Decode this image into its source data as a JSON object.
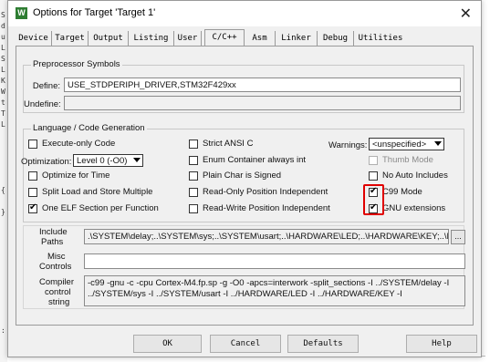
{
  "background": {
    "left_chars": [
      "S",
      "d",
      "u",
      "L",
      "S",
      "L",
      "K",
      "W",
      "t",
      "T",
      "L",
      "{",
      "}",
      ":"
    ]
  },
  "window": {
    "title": "Options for Target 'Target 1'",
    "app_icon_letter": "W",
    "close_glyph": "✕"
  },
  "tabs": [
    "Device",
    "Target",
    "Output",
    "Listing",
    "User",
    "C/C++",
    "Asm",
    "Linker",
    "Debug",
    "Utilities"
  ],
  "active_tab": "C/C++",
  "preprocessor": {
    "group_label": "Preprocessor Symbols",
    "define_label": "Define:",
    "define_value": "USE_STDPERIPH_DRIVER,STM32F429xx",
    "undefine_label": "Undefine:",
    "undefine_value": ""
  },
  "language": {
    "group_label": "Language / Code Generation",
    "checkboxes": [
      {
        "label": "Execute-only Code",
        "checked": false,
        "enabled": true
      },
      {
        "label": "Optimize for Time",
        "checked": false,
        "enabled": true
      },
      {
        "label": "Split Load and Store Multiple",
        "checked": false,
        "enabled": true
      },
      {
        "label": "One ELF Section per Function",
        "checked": true,
        "enabled": true
      },
      {
        "label": "Strict ANSI C",
        "checked": false,
        "enabled": true
      },
      {
        "label": "Enum Container always int",
        "checked": false,
        "enabled": true
      },
      {
        "label": "Plain Char is Signed",
        "checked": false,
        "enabled": true
      },
      {
        "label": "Read-Only Position Independent",
        "checked": false,
        "enabled": true
      },
      {
        "label": "Read-Write Position Independent",
        "checked": false,
        "enabled": true
      },
      {
        "label": "Thumb Mode",
        "checked": false,
        "enabled": false
      },
      {
        "label": "No Auto Includes",
        "checked": false,
        "enabled": true
      },
      {
        "label": "C99 Mode",
        "checked": true,
        "enabled": true
      },
      {
        "label": "GNU extensions",
        "checked": true,
        "enabled": true
      }
    ],
    "optimization_label": "Optimization:",
    "optimization_value": "Level 0 (-O0)",
    "warnings_label": "Warnings:",
    "warnings_value": "<unspecified>"
  },
  "include": {
    "include_label_line1": "Include",
    "include_label_line2": "Paths",
    "include_value": ".\\SYSTEM\\delay;..\\SYSTEM\\sys;..\\SYSTEM\\usart;..\\HARDWARE\\LED;..\\HARDWARE\\KEY;..\\H",
    "browse_label": "...",
    "misc_label_line1": "Misc",
    "misc_label_line2": "Controls",
    "misc_value": "",
    "compiler_label_line1": "Compiler",
    "compiler_label_line2": "control",
    "compiler_label_line3": "string",
    "compiler_line1": "-c99 -gnu -c -cpu Cortex-M4.fp.sp -g -O0 -apcs=interwork -split_sections -I ../SYSTEM/delay -I",
    "compiler_line2": "../SYSTEM/sys -I ../SYSTEM/usart -I ../HARDWARE/LED -I ../HARDWARE/KEY -I"
  },
  "buttons": {
    "ok": "OK",
    "cancel": "Cancel",
    "defaults": "Defaults",
    "help": "Help"
  },
  "colors": {
    "highlight": "#e00000",
    "dialog_bg": "#f0f0f0"
  },
  "icons": {
    "app": "keil-uvision-icon",
    "close": "close-icon",
    "corner": "resize-arrow-icon"
  }
}
